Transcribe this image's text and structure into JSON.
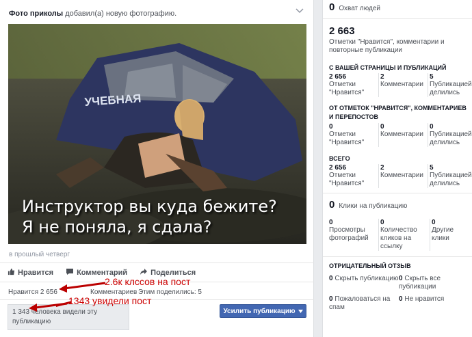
{
  "post": {
    "author": "Фото приколы",
    "action_text": " добавил(а) новую фотографию.",
    "caption_line1": "Инструктор вы куда бежите?",
    "caption_line2": "Я не поняла, я сдала?",
    "car_text": "УЧЕБНАЯ",
    "timestamp": "в прошлый четверг",
    "like_label": "Нравится",
    "comment_label": "Комментарий",
    "share_label": "Поделиться",
    "likes_count": "Нравится 2 656",
    "comments_count": "Комментариев",
    "shares_count": "Этим поделились: 5",
    "seen_text": "1 343 человека видели эту публикацию",
    "boost_label": "Усилить публикацию"
  },
  "annotations": {
    "a1": "2.6к клссов на пост",
    "a2": "1343 увидели пост"
  },
  "panel": {
    "reach_num": "0",
    "reach_label": "Охват людей",
    "total_num": "2 663",
    "total_label": "Отметки \"Нравится\", комментарии и повторные публикации",
    "sec1_title": "С ВАШЕЙ СТРАНИЦЫ И ПУБЛИКАЦИЙ",
    "sec1": [
      {
        "v": "2 656",
        "l": "Отметки \"Нравится\""
      },
      {
        "v": "2",
        "l": "Комментарии"
      },
      {
        "v": "5",
        "l": "Публикацией делились"
      }
    ],
    "sec2_title": "ОТ ОТМЕТОК \"НРАВИТСЯ\", КОММЕНТАРИЕВ И ПЕРЕПОСТОВ",
    "sec2": [
      {
        "v": "0",
        "l": "Отметки \"Нравится\""
      },
      {
        "v": "0",
        "l": "Комментарии"
      },
      {
        "v": "0",
        "l": "Публикацией делились"
      }
    ],
    "sec3_title": "ВСЕГО",
    "sec3": [
      {
        "v": "2 656",
        "l": "Отметки \"Нравится\""
      },
      {
        "v": "2",
        "l": "Комментарии"
      },
      {
        "v": "5",
        "l": "Публикацией делились"
      }
    ],
    "clicks_num": "0",
    "clicks_label": "Клики на публикацию",
    "clicks": [
      {
        "v": "0",
        "l": "Просмотры фотографий"
      },
      {
        "v": "0",
        "l": "Количество кликов на ссылку"
      },
      {
        "v": "0",
        "l": "Другие клики"
      }
    ],
    "neg_title": "ОТРИЦАТЕЛЬНЫЙ ОТЗЫВ",
    "neg": [
      {
        "v": "0",
        "l": "Скрыть публикацию"
      },
      {
        "v": "0",
        "l": "Скрыть все публикации"
      },
      {
        "v": "0",
        "l": "Пожаловаться на спам"
      },
      {
        "v": "0",
        "l": "Не нравится"
      }
    ]
  }
}
